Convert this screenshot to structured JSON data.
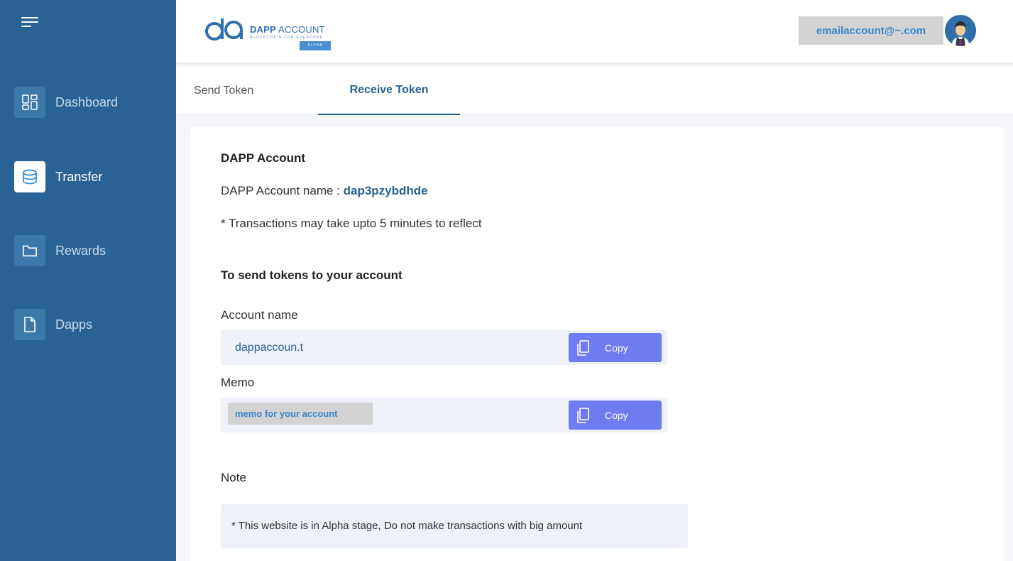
{
  "sidebar": {
    "menu_icon": "hamburger-icon",
    "items": [
      {
        "label": "Dashboard",
        "icon": "dashboard-icon",
        "active": false
      },
      {
        "label": "Transfer",
        "icon": "database-icon",
        "active": true
      },
      {
        "label": "Rewards",
        "icon": "folder-icon",
        "active": false
      },
      {
        "label": "Dapps",
        "icon": "file-icon",
        "active": false
      }
    ]
  },
  "header": {
    "logo": {
      "mark": "da",
      "title_bold": "DAPP",
      "title_rest": " ACCOUNT",
      "subtitle": "BLOCKCHAIN FOR EVERYONE",
      "badge": "ALPHA"
    },
    "email": "emailaccount@~.com",
    "avatar_icon": "user-avatar-icon"
  },
  "tabs": [
    {
      "label": "Send Token",
      "active": false
    },
    {
      "label": "Receive Token",
      "active": true
    }
  ],
  "content": {
    "section_title": "DAPP Account",
    "account_name_prefix": "DAPP Account name : ",
    "account_name_value": "dap3pzybdhde",
    "transaction_note": "* Transactions may take upto 5 minutes to reflect",
    "send_title": "To send tokens to your account",
    "account_label": "Account name",
    "account_value": "dappaccoun.t",
    "memo_label": "Memo",
    "memo_value": "memo for your account",
    "copy_label": "Copy",
    "note_title": "Note",
    "note_text": "* This website is in Alpha stage, Do not make transactions with big amount"
  },
  "colors": {
    "sidebar": "#2a6293",
    "accent": "#2a6293",
    "copy_button": "#6f7bf0",
    "field_bg": "#eef1f8"
  }
}
